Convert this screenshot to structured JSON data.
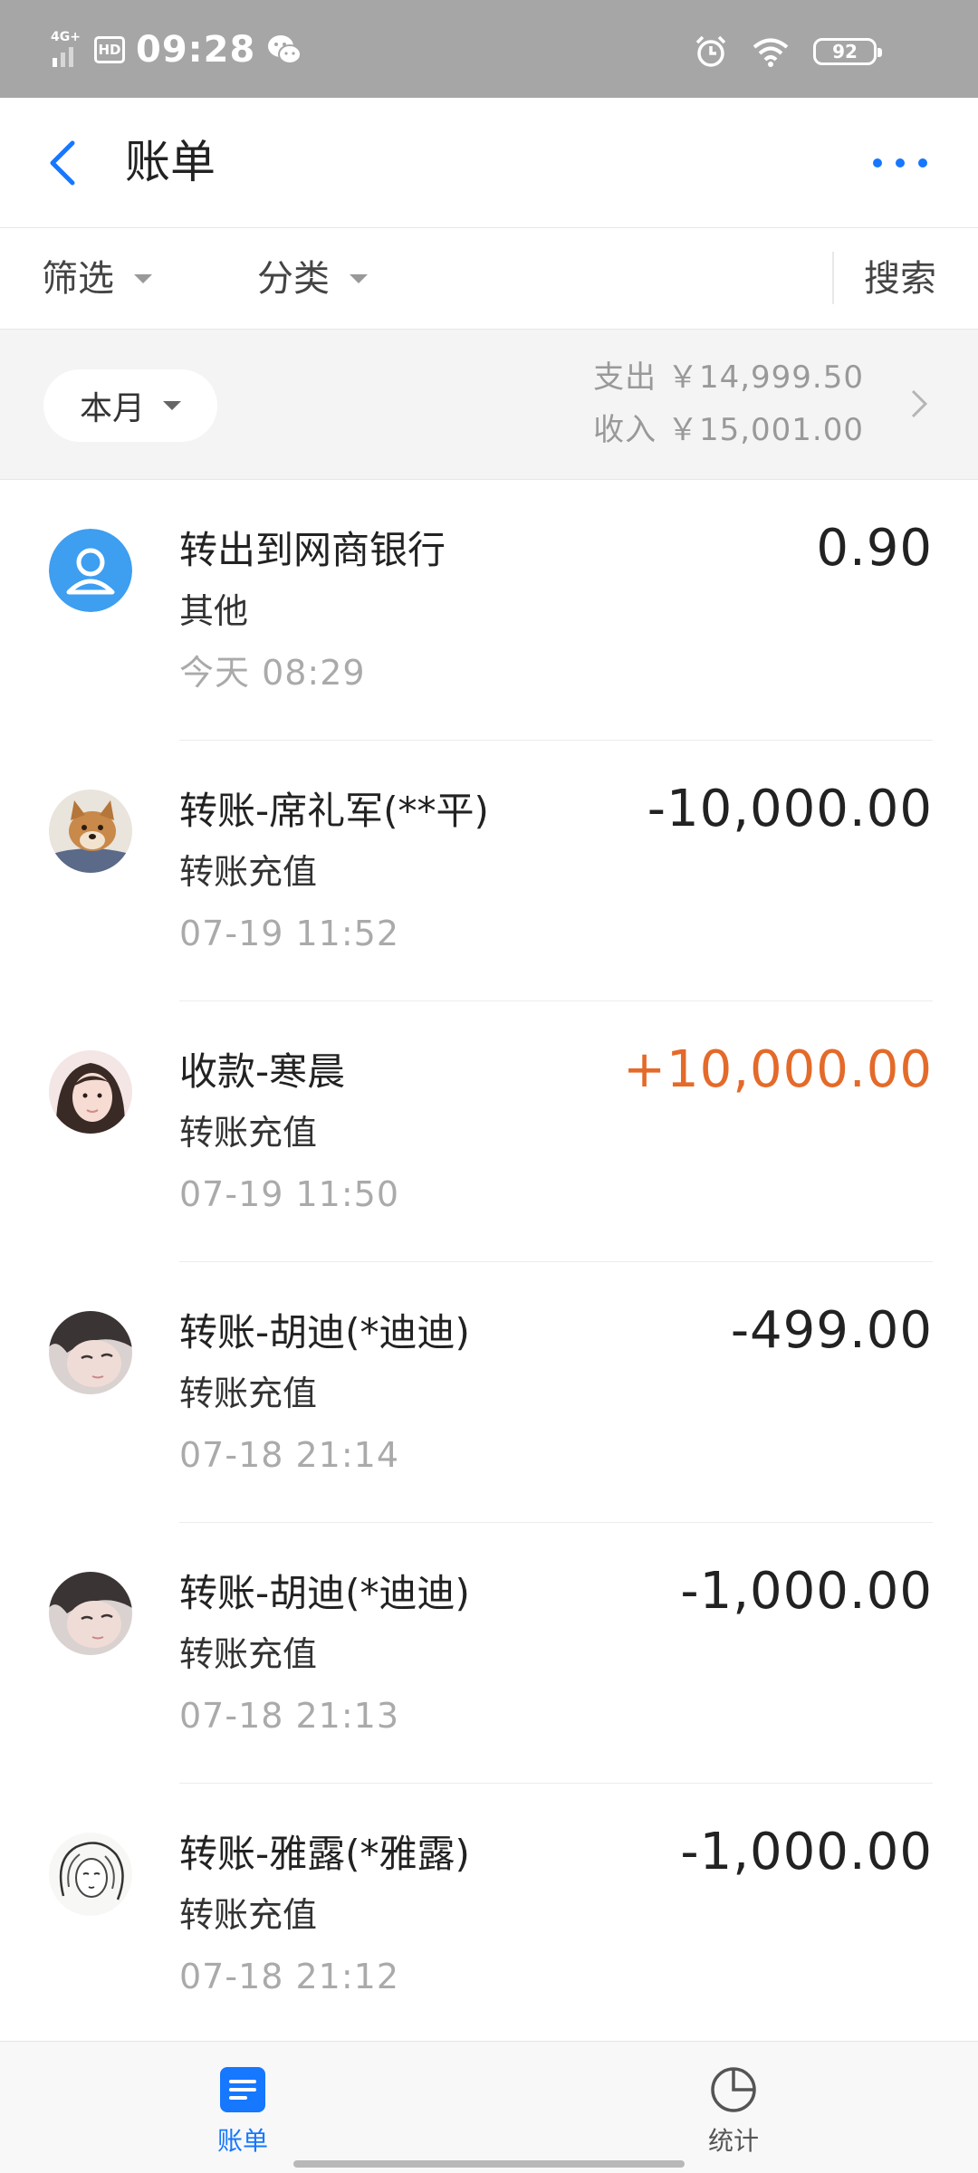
{
  "status_bar": {
    "network": "4G+",
    "hd": "HD",
    "time": "09:28",
    "battery": "92",
    "icons": [
      "signal-icon",
      "hd-icon",
      "wechat-icon",
      "alarm-icon",
      "wifi-icon",
      "battery-icon"
    ]
  },
  "nav": {
    "title": "账单",
    "back_icon": "chevron-left-icon",
    "more_icon": "more-dots-icon",
    "accent": "#1677ff"
  },
  "filters": {
    "filter_label": "筛选",
    "category_label": "分类",
    "search_label": "搜索"
  },
  "summary": {
    "month_label": "本月",
    "expense": "支出 ￥14,999.50",
    "income": "收入 ￥15,001.00"
  },
  "transactions": [
    {
      "name": "转出到网商银行",
      "category": "其他",
      "time": "今天  08:29",
      "amount": "0.90",
      "type": "neutral",
      "avatar": "default-user"
    },
    {
      "name": "转账-席礼军(**平)",
      "category": "转账充值",
      "time": "07-19  11:52",
      "amount": "-10,000.00",
      "type": "expense",
      "avatar": "dog-photo"
    },
    {
      "name": "收款-寒晨",
      "category": "转账充值",
      "time": "07-19  11:50",
      "amount": "+10,000.00",
      "type": "income",
      "avatar": "girl-photo"
    },
    {
      "name": "转账-胡迪(*迪迪)",
      "category": "转账充值",
      "time": "07-18  21:14",
      "amount": "-499.00",
      "type": "expense",
      "avatar": "face-photo"
    },
    {
      "name": "转账-胡迪(*迪迪)",
      "category": "转账充值",
      "time": "07-18  21:13",
      "amount": "-1,000.00",
      "type": "expense",
      "avatar": "face-photo"
    },
    {
      "name": "转账-雅露(*雅露)",
      "category": "转账充值",
      "time": "07-18  21:12",
      "amount": "-1,000.00",
      "type": "expense",
      "avatar": "sketch-portrait"
    }
  ],
  "colors": {
    "income": "#e46a2a",
    "active_tab": "#1677ff",
    "inactive_tab": "#555555"
  },
  "tabs": [
    {
      "label": "账单",
      "icon": "bill-list-icon",
      "active": true
    },
    {
      "label": "统计",
      "icon": "pie-chart-icon",
      "active": false
    }
  ]
}
